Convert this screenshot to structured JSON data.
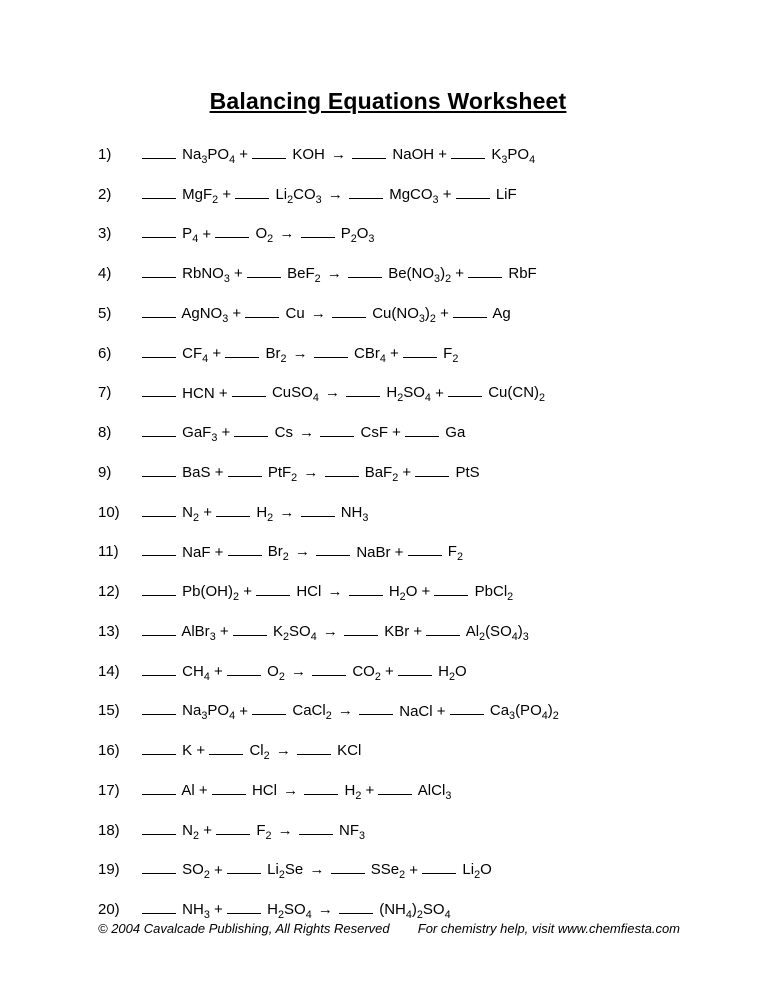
{
  "title": "Balancing Equations Worksheet",
  "arrow_glyph": "→",
  "blank_token": "____",
  "footer": {
    "left": "© 2004 Cavalcade Publishing, All Rights Reserved",
    "right": "For chemistry help, visit www.chemfiesta.com"
  },
  "problems": [
    {
      "n": "1)",
      "terms": [
        [
          "Na",
          3,
          "PO",
          4
        ],
        "+",
        [
          "KOH"
        ],
        "→",
        [
          "NaOH"
        ],
        "+",
        [
          "K",
          3,
          "PO",
          4
        ]
      ]
    },
    {
      "n": "2)",
      "terms": [
        [
          "MgF",
          2
        ],
        "+",
        [
          "Li",
          2,
          "CO",
          3
        ],
        "→",
        [
          "MgCO",
          3
        ],
        "+",
        [
          "LiF"
        ]
      ]
    },
    {
      "n": "3)",
      "terms": [
        [
          "P",
          4
        ],
        "+",
        [
          "O",
          2
        ],
        "→",
        [
          "P",
          2,
          "O",
          3
        ]
      ]
    },
    {
      "n": "4)",
      "terms": [
        [
          "RbNO",
          3
        ],
        "+",
        [
          "BeF",
          2
        ],
        "→",
        [
          "Be(NO",
          3,
          ")",
          2
        ],
        "+",
        [
          "RbF"
        ]
      ]
    },
    {
      "n": "5)",
      "terms": [
        [
          "AgNO",
          3
        ],
        "+",
        [
          "Cu"
        ],
        "→",
        [
          "Cu(NO",
          3,
          ")",
          2
        ],
        "+",
        [
          "Ag"
        ]
      ]
    },
    {
      "n": "6)",
      "terms": [
        [
          "CF",
          4
        ],
        "+",
        [
          "Br",
          2
        ],
        "→",
        [
          "CBr",
          4
        ],
        "+",
        [
          "F",
          2
        ]
      ]
    },
    {
      "n": "7)",
      "terms": [
        [
          "HCN"
        ],
        "+",
        [
          "CuSO",
          4
        ],
        "→",
        [
          "H",
          2,
          "SO",
          4
        ],
        "+",
        [
          "Cu(CN)",
          2
        ]
      ]
    },
    {
      "n": "8)",
      "terms": [
        [
          "GaF",
          3
        ],
        "+",
        [
          "Cs"
        ],
        "→",
        [
          "CsF"
        ],
        "+",
        [
          "Ga"
        ]
      ]
    },
    {
      "n": "9)",
      "terms": [
        [
          "BaS"
        ],
        "+",
        [
          "PtF",
          2
        ],
        "→",
        [
          "BaF",
          2
        ],
        "+",
        [
          "PtS"
        ]
      ]
    },
    {
      "n": "10)",
      "terms": [
        [
          "N",
          2
        ],
        "+",
        [
          "H",
          2
        ],
        "→",
        [
          "NH",
          3
        ]
      ]
    },
    {
      "n": "11)",
      "terms": [
        [
          "NaF"
        ],
        "+",
        [
          "Br",
          2
        ],
        "→",
        [
          "NaBr"
        ],
        "+",
        [
          "F",
          2
        ]
      ]
    },
    {
      "n": "12)",
      "terms": [
        [
          "Pb(OH)",
          2
        ],
        "+",
        [
          "HCl"
        ],
        "→",
        [
          "H",
          2,
          "O"
        ],
        "+",
        [
          "PbCl",
          2
        ]
      ]
    },
    {
      "n": "13)",
      "terms": [
        [
          "AlBr",
          3
        ],
        "+",
        [
          "K",
          2,
          "SO",
          4
        ],
        "→",
        [
          "KBr"
        ],
        "+",
        [
          "Al",
          2,
          "(SO",
          4,
          ")",
          3
        ]
      ]
    },
    {
      "n": "14)",
      "terms": [
        [
          "CH",
          4
        ],
        "+",
        [
          "O",
          2
        ],
        "→",
        [
          "CO",
          2
        ],
        "+",
        [
          "H",
          2,
          "O"
        ]
      ]
    },
    {
      "n": "15)",
      "terms": [
        [
          "Na",
          3,
          "PO",
          4
        ],
        "+",
        [
          "CaCl",
          2
        ],
        "→",
        [
          "NaCl"
        ],
        "+",
        [
          "Ca",
          3,
          "(PO",
          4,
          ")",
          2
        ]
      ]
    },
    {
      "n": "16)",
      "terms": [
        [
          "K"
        ],
        "+",
        [
          "Cl",
          2
        ],
        "→",
        [
          "KCl"
        ]
      ]
    },
    {
      "n": "17)",
      "terms": [
        [
          "Al"
        ],
        "+",
        [
          "HCl"
        ],
        "→",
        [
          "H",
          2
        ],
        "+",
        [
          "AlCl",
          3
        ]
      ]
    },
    {
      "n": "18)",
      "terms": [
        [
          "N",
          2
        ],
        "+",
        [
          "F",
          2
        ],
        "→",
        [
          "NF",
          3
        ]
      ]
    },
    {
      "n": "19)",
      "terms": [
        [
          "SO",
          2
        ],
        "+",
        [
          "Li",
          2,
          "Se"
        ],
        "→",
        [
          "SSe",
          2
        ],
        "+",
        [
          "Li",
          2,
          "O"
        ]
      ]
    },
    {
      "n": "20)",
      "terms": [
        [
          "NH",
          3
        ],
        "+",
        [
          "H",
          2,
          "SO",
          4
        ],
        "→",
        [
          "(NH",
          4,
          ")",
          2,
          "SO",
          4
        ]
      ]
    }
  ]
}
